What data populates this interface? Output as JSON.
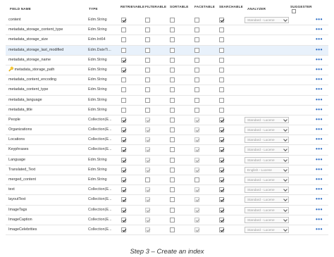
{
  "header": {
    "field_name": "FIELD NAME",
    "type": "TYPE",
    "retrievable": "RETRIEVABLE",
    "filterable": "FILTERABLE",
    "sortable": "SORTABLE",
    "facetable": "FACETABLE",
    "searchable": "SEARCHABLE",
    "analyzer": "ANALYZER",
    "suggester": "SUGGESTER"
  },
  "row_more_label": "•••",
  "key_icon": "🔑",
  "rows": [
    {
      "name": "content",
      "type": "Edm.String",
      "retrievable": true,
      "filterable": false,
      "sortable": false,
      "facetable": false,
      "searchable": true,
      "analyzer": "Standard - Lucene"
    },
    {
      "name": "metadata_storage_content_type",
      "type": "Edm.String",
      "retrievable": false,
      "filterable": false,
      "sortable": false,
      "facetable": false,
      "searchable": false,
      "analyzer": null
    },
    {
      "name": "metadata_storage_size",
      "type": "Edm.Int64",
      "retrievable": false,
      "filterable": false,
      "sortable": false,
      "facetable": false,
      "searchable": false,
      "analyzer": null
    },
    {
      "name": "metadata_storage_last_modified",
      "type": "Edm.DateTi...",
      "retrievable": false,
      "filterable": false,
      "sortable": false,
      "facetable": false,
      "searchable": false,
      "analyzer": null,
      "selected": true
    },
    {
      "name": "metadata_storage_name",
      "type": "Edm.String",
      "retrievable": true,
      "filterable": false,
      "sortable": false,
      "facetable": false,
      "searchable": false,
      "analyzer": null
    },
    {
      "name": "metadata_storage_path",
      "type": "Edm.String",
      "retrievable": true,
      "filterable": false,
      "sortable": false,
      "facetable": false,
      "searchable": false,
      "analyzer": null,
      "key": true
    },
    {
      "name": "metadata_content_encoding",
      "type": "Edm.String",
      "retrievable": false,
      "filterable": false,
      "sortable": false,
      "facetable": false,
      "searchable": false,
      "analyzer": null
    },
    {
      "name": "metadata_content_type",
      "type": "Edm.String",
      "retrievable": false,
      "filterable": false,
      "sortable": false,
      "facetable": false,
      "searchable": false,
      "analyzer": null
    },
    {
      "name": "metadata_language",
      "type": "Edm.String",
      "retrievable": false,
      "filterable": false,
      "sortable": false,
      "facetable": false,
      "searchable": false,
      "analyzer": null
    },
    {
      "name": "metadata_title",
      "type": "Edm.String",
      "retrievable": false,
      "filterable": false,
      "sortable": false,
      "facetable": false,
      "searchable": false,
      "analyzer": null
    },
    {
      "name": "People",
      "type": "Collection(E...",
      "retrievable": true,
      "filterable": true,
      "sortable": false,
      "facetable": true,
      "searchable": true,
      "analyzer": "Standard - Lucene"
    },
    {
      "name": "Organizations",
      "type": "Collection(E...",
      "retrievable": true,
      "filterable": true,
      "sortable": false,
      "facetable": true,
      "searchable": true,
      "analyzer": "Standard - Lucene"
    },
    {
      "name": "Locations",
      "type": "Collection(E...",
      "retrievable": true,
      "filterable": true,
      "sortable": false,
      "facetable": true,
      "searchable": true,
      "analyzer": "Standard - Lucene"
    },
    {
      "name": "Keyphrases",
      "type": "Collection(E...",
      "retrievable": true,
      "filterable": true,
      "sortable": false,
      "facetable": true,
      "searchable": true,
      "analyzer": "Standard - Lucene"
    },
    {
      "name": "Language",
      "type": "Edm.String",
      "retrievable": true,
      "filterable": true,
      "sortable": false,
      "facetable": true,
      "searchable": true,
      "analyzer": "Standard - Lucene"
    },
    {
      "name": "Translated_Text",
      "type": "Edm.String",
      "retrievable": true,
      "filterable": true,
      "sortable": false,
      "facetable": true,
      "searchable": true,
      "analyzer": "English - Lucene"
    },
    {
      "name": "merged_content",
      "type": "Edm.String",
      "retrievable": true,
      "filterable": false,
      "sortable": false,
      "facetable": false,
      "searchable": true,
      "analyzer": "Standard - Lucene"
    },
    {
      "name": "text",
      "type": "Collection(E...",
      "retrievable": true,
      "filterable": true,
      "sortable": false,
      "facetable": true,
      "searchable": true,
      "analyzer": "Standard - Lucene"
    },
    {
      "name": "layoutText",
      "type": "Collection(E...",
      "retrievable": true,
      "filterable": true,
      "sortable": false,
      "facetable": true,
      "searchable": true,
      "analyzer": "Standard - Lucene"
    },
    {
      "name": "ImageTags",
      "type": "Collection(E...",
      "retrievable": true,
      "filterable": true,
      "sortable": false,
      "facetable": true,
      "searchable": true,
      "analyzer": "Standard - Lucene"
    },
    {
      "name": "ImageCaption",
      "type": "Collection(E...",
      "retrievable": true,
      "filterable": true,
      "sortable": false,
      "facetable": true,
      "searchable": true,
      "analyzer": "Standard - Lucene"
    },
    {
      "name": "ImageCelebrities",
      "type": "Collection(E...",
      "retrievable": true,
      "filterable": true,
      "sortable": false,
      "facetable": true,
      "searchable": true,
      "analyzer": "Standard - Lucene"
    }
  ],
  "caption": "Step 3 – Create an index"
}
